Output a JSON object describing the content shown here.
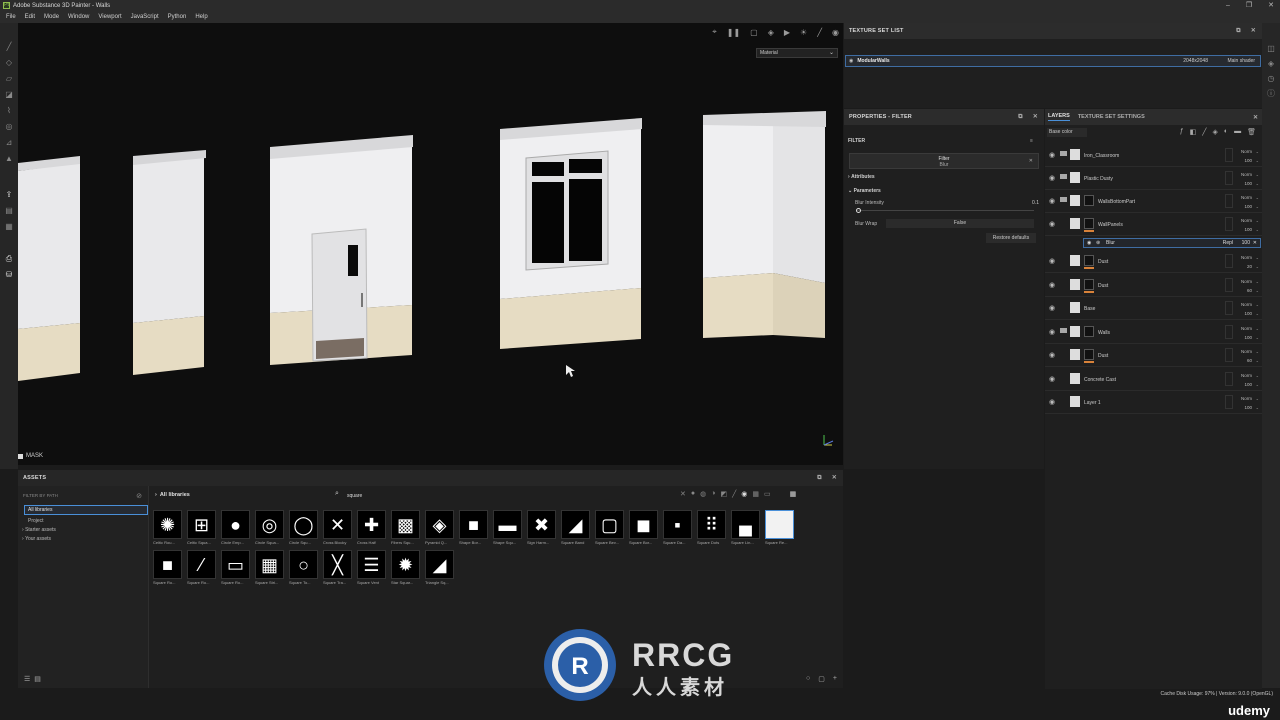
{
  "app": {
    "title": "Adobe Substance 3D Painter - Walls",
    "logo_letter": "Pt"
  },
  "menu": [
    "File",
    "Edit",
    "Mode",
    "Window",
    "Viewport",
    "JavaScript",
    "Python",
    "Help"
  ],
  "viewport": {
    "material_dropdown": "Material",
    "mask_label": "MASK"
  },
  "texture_set_list": {
    "title": "TEXTURE SET LIST",
    "row": {
      "name": "ModularWalls",
      "resolution": "2048x2048",
      "shader": "Main shader"
    }
  },
  "properties": {
    "title": "PROPERTIES - FILTER",
    "filter_section": "FILTER",
    "filter_title": "Filter",
    "filter_subtitle": "Blur",
    "attributes": "Attributes",
    "parameters": "Parameters",
    "blur_intensity_label": "Blur Intensity",
    "blur_intensity_value": "0.1",
    "blur_wrap_label": "Blur Wrap",
    "blur_wrap_value": "False",
    "restore_defaults": "Restore defaults"
  },
  "layers_panel": {
    "tab_layers": "LAYERS",
    "tab_settings": "TEXTURE SET SETTINGS",
    "channel": "Base color",
    "layers": [
      {
        "name": "Iron_Classroom",
        "mode": "Norm",
        "opacity": "100",
        "folder": true
      },
      {
        "name": "Plastic Dusty",
        "mode": "Norm",
        "opacity": "100",
        "folder": true
      },
      {
        "name": "WallsBottomPart",
        "mode": "Norm",
        "opacity": "100",
        "folder": true
      },
      {
        "name": "WallPanels",
        "mode": "Norm",
        "opacity": "100",
        "folder": false
      },
      {
        "name": "Dust",
        "mode": "Norm",
        "opacity": "20",
        "folder": false
      },
      {
        "name": "Dust",
        "mode": "Norm",
        "opacity": "60",
        "folder": false
      },
      {
        "name": "Base",
        "mode": "Norm",
        "opacity": "100",
        "folder": false
      },
      {
        "name": "Walls",
        "mode": "Norm",
        "opacity": "100",
        "folder": true
      },
      {
        "name": "Dust",
        "mode": "Norm",
        "opacity": "60",
        "folder": false
      },
      {
        "name": "Concrete Cast",
        "mode": "Norm",
        "opacity": "100",
        "folder": false
      },
      {
        "name": "Layer 1",
        "mode": "Norm",
        "opacity": "100",
        "folder": false
      }
    ],
    "blur_effect": {
      "name": "Blur",
      "mode": "Repl",
      "opacity": "100"
    }
  },
  "assets": {
    "title": "ASSETS",
    "filter_by_path": "FILTER BY PATH",
    "libraries": [
      "All libraries",
      "Project",
      "Starter assets",
      "Your assets"
    ],
    "breadcrumb": "All libraries",
    "search_value": "square",
    "items": [
      "Celtic Rou...",
      "Celtic Squa...",
      "Circle Emp...",
      "Circle Squa...",
      "Circle Squ...",
      "Cross Blocky",
      "Cross Half",
      "Fibers Squ...",
      "Pyramid Q...",
      "Shape Bor...",
      "Shape Squ...",
      "Sign Harm...",
      "Square Band",
      "Square Bev...",
      "Square Bor...",
      "Square Da...",
      "Square Dots",
      "Square Lin...",
      "Square Re...",
      "Square Ro...",
      "Square Ro...",
      "Square Ro...",
      "Square Stri...",
      "Square To...",
      "Square Tra...",
      "Square Vent",
      "Star Squar...",
      "Triangle Sq..."
    ]
  },
  "status": {
    "cache": "Cache Disk Usage:   97% | Version: 9.0.0 (OpenGL)",
    "udemy": "udemy"
  },
  "watermark": {
    "brand": "RRCG",
    "sub": "人人素材"
  },
  "colors": {
    "accent": "#4a90d9",
    "orange": "#d8823a",
    "wall": "#e9e9eb",
    "panel": "#e6dcc3"
  }
}
